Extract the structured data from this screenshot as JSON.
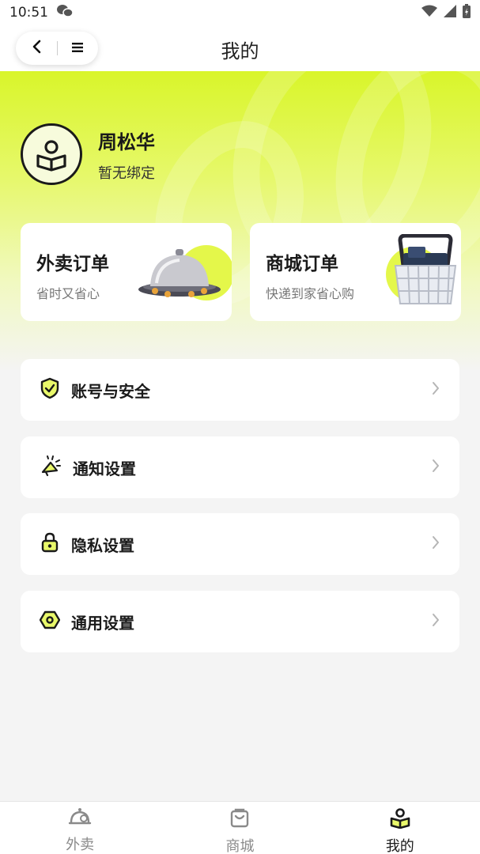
{
  "status_bar": {
    "time": "10:51"
  },
  "header": {
    "title": "我的"
  },
  "profile": {
    "name": "周松华",
    "subtitle": "暂无绑定"
  },
  "order_cards": [
    {
      "title": "外卖订单",
      "subtitle": "省时又省心",
      "icon": "food-cloche-icon"
    },
    {
      "title": "商城订单",
      "subtitle": "快递到家省心购",
      "icon": "shopping-basket-icon"
    }
  ],
  "menu": [
    {
      "label": "账号与安全",
      "icon": "shield-check-icon"
    },
    {
      "label": "通知设置",
      "icon": "megaphone-icon"
    },
    {
      "label": "隐私设置",
      "icon": "lock-icon"
    },
    {
      "label": "通用设置",
      "icon": "hex-settings-icon"
    }
  ],
  "tabs": [
    {
      "label": "外卖",
      "icon": "takeout-icon",
      "active": false
    },
    {
      "label": "商城",
      "icon": "shopping-bag-icon",
      "active": false
    },
    {
      "label": "我的",
      "icon": "profile-book-icon",
      "active": true
    }
  ],
  "colors": {
    "accent": "#d9f52a",
    "icon_fill": "#e9f86a",
    "text": "#1a1a1a",
    "muted": "#8a8a8a"
  }
}
